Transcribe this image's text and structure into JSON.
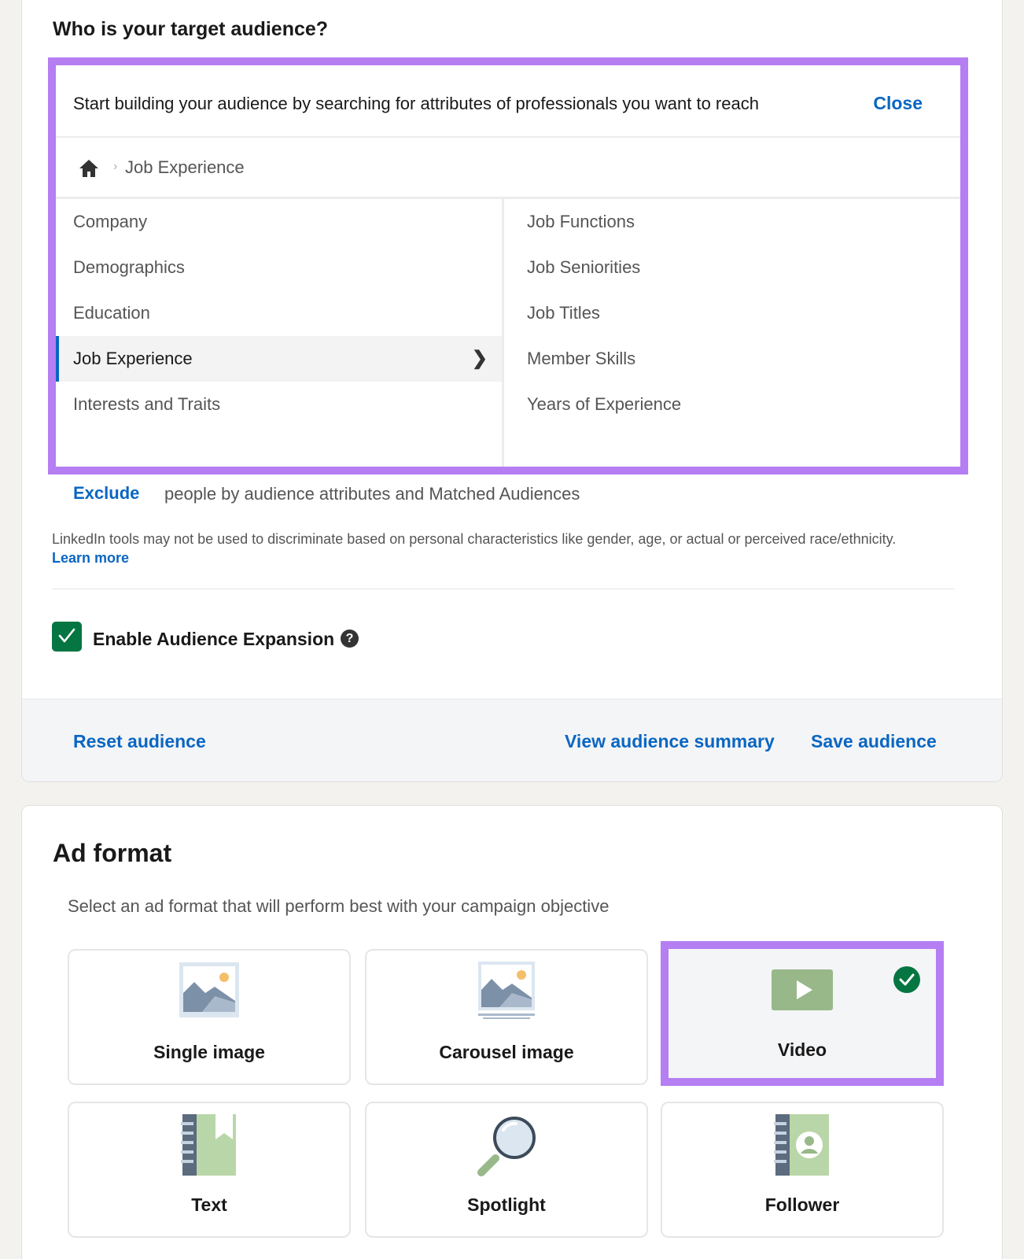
{
  "audience": {
    "title": "Who is your target audience?",
    "hint": "Start building your audience by searching for attributes of professionals you want to reach",
    "close_label": "Close",
    "breadcrumb": {
      "current": "Job Experience"
    },
    "categories": [
      "Company",
      "Demographics",
      "Education",
      "Job Experience",
      "Interests and Traits"
    ],
    "selected_category": "Job Experience",
    "subcategories": [
      "Job Functions",
      "Job Seniorities",
      "Job Titles",
      "Member Skills",
      "Years of Experience"
    ],
    "exclude_label": "Exclude",
    "exclude_text": "people by audience attributes and Matched Audiences",
    "disclaimer": "LinkedIn tools may not be used to discriminate based on personal characteristics like gender, age, or actual or perceived race/ethnicity.",
    "learn_more": "Learn more",
    "expansion": {
      "label": "Enable Audience Expansion",
      "checked": true
    },
    "footer": {
      "reset": "Reset audience",
      "view_summary": "View audience summary",
      "save": "Save audience"
    }
  },
  "ad_format": {
    "title": "Ad format",
    "subtitle": "Select an ad format that will perform best with your campaign objective",
    "options": [
      {
        "label": "Single image",
        "icon": "single-image-icon",
        "selected": false
      },
      {
        "label": "Carousel image",
        "icon": "carousel-image-icon",
        "selected": false
      },
      {
        "label": "Video",
        "icon": "video-icon",
        "selected": true
      },
      {
        "label": "Text",
        "icon": "text-icon",
        "selected": false
      },
      {
        "label": "Spotlight",
        "icon": "spotlight-icon",
        "selected": false
      },
      {
        "label": "Follower",
        "icon": "follower-icon",
        "selected": false
      }
    ]
  },
  "colors": {
    "link": "#0a66c2",
    "highlight": "#b57ef3",
    "success": "#057642"
  }
}
